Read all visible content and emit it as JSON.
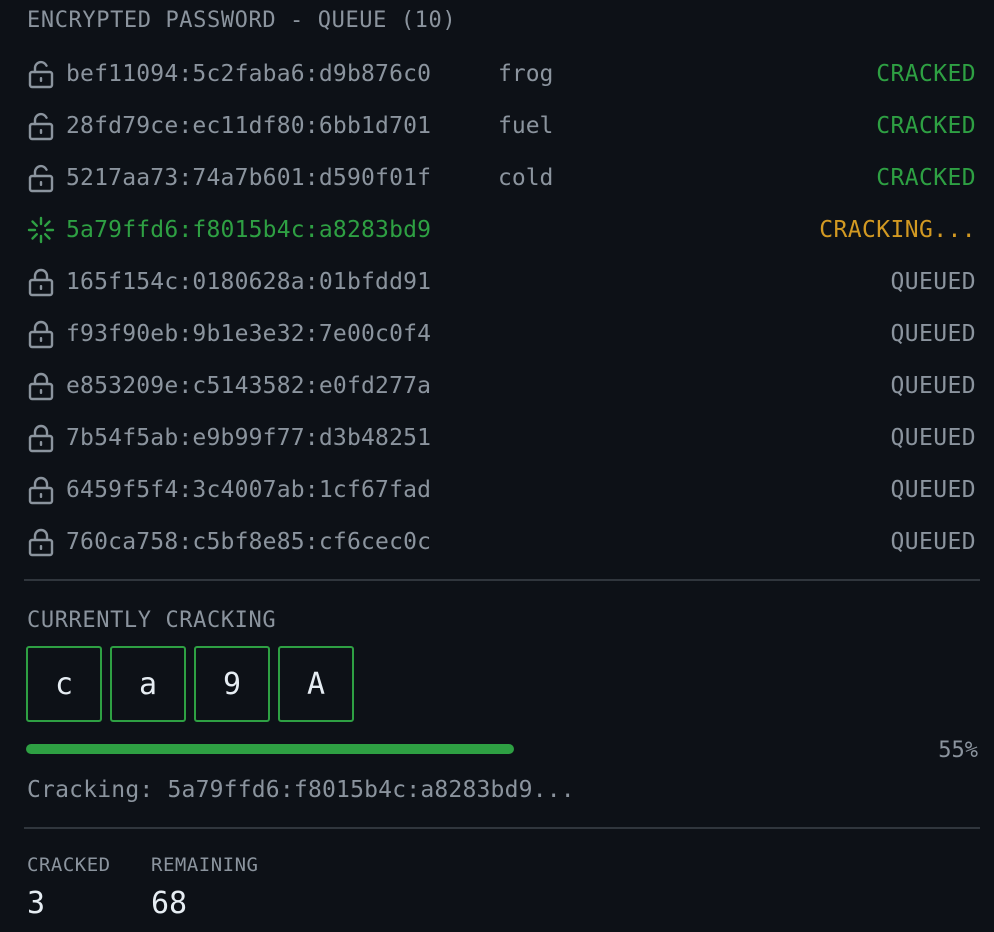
{
  "queue": {
    "title": "ENCRYPTED PASSWORD - QUEUE (10)",
    "rows": [
      {
        "hash": "bef11094:5c2faba6:d9b876c0",
        "plain": "frog",
        "status": "CRACKED",
        "state": "cracked",
        "icon": "unlock-icon"
      },
      {
        "hash": "28fd79ce:ec11df80:6bb1d701",
        "plain": "fuel",
        "status": "CRACKED",
        "state": "cracked",
        "icon": "unlock-icon"
      },
      {
        "hash": "5217aa73:74a7b601:d590f01f",
        "plain": "cold",
        "status": "CRACKED",
        "state": "cracked",
        "icon": "unlock-icon"
      },
      {
        "hash": "5a79ffd6:f8015b4c:a8283bd9",
        "plain": "",
        "status": "CRACKING...",
        "state": "cracking",
        "icon": "spinner-icon"
      },
      {
        "hash": "165f154c:0180628a:01bfdd91",
        "plain": "",
        "status": "QUEUED",
        "state": "queued",
        "icon": "lock-icon"
      },
      {
        "hash": "f93f90eb:9b1e3e32:7e00c0f4",
        "plain": "",
        "status": "QUEUED",
        "state": "queued",
        "icon": "lock-icon"
      },
      {
        "hash": "e853209e:c5143582:e0fd277a",
        "plain": "",
        "status": "QUEUED",
        "state": "queued",
        "icon": "lock-icon"
      },
      {
        "hash": "7b54f5ab:e9b99f77:d3b48251",
        "plain": "",
        "status": "QUEUED",
        "state": "queued",
        "icon": "lock-icon"
      },
      {
        "hash": "6459f5f4:3c4007ab:1cf67fad",
        "plain": "",
        "status": "QUEUED",
        "state": "queued",
        "icon": "lock-icon"
      },
      {
        "hash": "760ca758:c5bf8e85:cf6cec0c",
        "plain": "",
        "status": "QUEUED",
        "state": "queued",
        "icon": "lock-icon"
      }
    ]
  },
  "current": {
    "title": "CURRENTLY CRACKING",
    "chars": [
      "c",
      "a",
      "9",
      "A"
    ],
    "progress": 0.55,
    "progress_label": "55%",
    "status_line": "Cracking: 5a79ffd6:f8015b4c:a8283bd9..."
  },
  "stats": {
    "cracked_label": "CRACKED",
    "cracked_value": "3",
    "remaining_label": "REMAINING",
    "remaining_value": "68"
  },
  "colors": {
    "background": "#0d1117",
    "text": "#8b949e",
    "success": "#2ea043",
    "warning": "#d29922",
    "bright": "#e6edf3"
  }
}
